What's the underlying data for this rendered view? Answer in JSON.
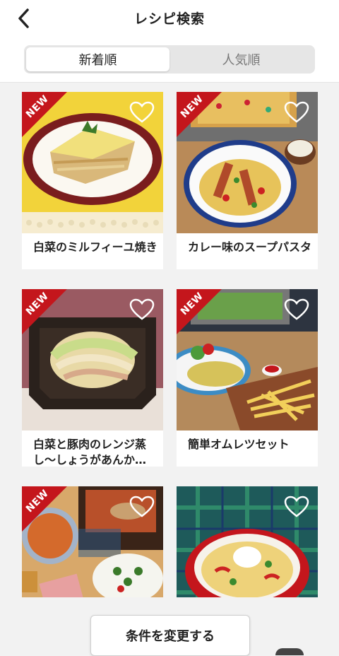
{
  "header": {
    "title": "レシピ検索",
    "back_icon": "chevron-left-icon"
  },
  "tabs": [
    {
      "label": "新着順",
      "selected": true
    },
    {
      "label": "人気順",
      "selected": false
    }
  ],
  "recipes": [
    {
      "name": "白菜のミルフィーユ焼き",
      "badge": "NEW",
      "favorite_icon": "heart-outline-icon"
    },
    {
      "name": "カレー味のスープパスタ",
      "badge": "NEW",
      "favorite_icon": "heart-outline-icon"
    },
    {
      "name": "白菜と豚肉のレンジ蒸し〜しょうがあんか…",
      "badge": "NEW",
      "favorite_icon": "heart-outline-icon"
    },
    {
      "name": "簡単オムレツセット",
      "badge": "NEW",
      "favorite_icon": "heart-outline-icon"
    },
    {
      "name": "",
      "badge": "NEW",
      "favorite_icon": "heart-outline-icon"
    },
    {
      "name": "",
      "badge": "",
      "favorite_icon": "heart-outline-icon"
    }
  ],
  "footer": {
    "change_conditions_label": "条件を変更する"
  },
  "colors": {
    "badge_red": "#c4161c",
    "background": "#f2f2f2"
  }
}
